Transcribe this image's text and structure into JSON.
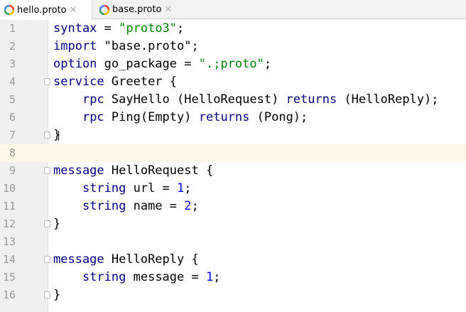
{
  "tabs": [
    {
      "label": "hello.proto",
      "active": true
    },
    {
      "label": "base.proto",
      "active": false
    }
  ],
  "colors": {
    "keyword": "#000080",
    "string": "#008000",
    "number": "#0000ff",
    "current_line": "#fdf8e5"
  },
  "lines": [
    {
      "num": "1",
      "tokens": [
        {
          "t": "syntax",
          "c": "kw"
        },
        {
          "t": " = "
        },
        {
          "t": "\"proto3\"",
          "c": "str"
        },
        {
          "t": ";"
        }
      ]
    },
    {
      "num": "2",
      "tokens": [
        {
          "t": "import",
          "c": "kw"
        },
        {
          "t": " \"base.proto\";"
        }
      ]
    },
    {
      "num": "3",
      "tokens": [
        {
          "t": "option",
          "c": "kw"
        },
        {
          "t": " go_package = "
        },
        {
          "t": "\".;proto\"",
          "c": "str"
        },
        {
          "t": ";"
        }
      ]
    },
    {
      "num": "4",
      "fold": true,
      "tokens": [
        {
          "t": "service",
          "c": "kw"
        },
        {
          "t": " Greeter {"
        }
      ]
    },
    {
      "num": "5",
      "tokens": [
        {
          "t": "    "
        },
        {
          "t": "rpc",
          "c": "kw"
        },
        {
          "t": " SayHello (HelloRequest) "
        },
        {
          "t": "returns",
          "c": "kw"
        },
        {
          "t": " (HelloReply);"
        }
      ]
    },
    {
      "num": "6",
      "tokens": [
        {
          "t": "    "
        },
        {
          "t": "rpc",
          "c": "kw"
        },
        {
          "t": " Ping(Empty) "
        },
        {
          "t": "returns",
          "c": "kw"
        },
        {
          "t": " (Pong);"
        }
      ]
    },
    {
      "num": "7",
      "fold": true,
      "caret": true,
      "tokens": [
        {
          "t": "}"
        }
      ]
    },
    {
      "num": "8",
      "current": true,
      "tokens": []
    },
    {
      "num": "9",
      "fold": true,
      "tokens": [
        {
          "t": "message",
          "c": "kw"
        },
        {
          "t": " HelloRequest {"
        }
      ]
    },
    {
      "num": "10",
      "tokens": [
        {
          "t": "    "
        },
        {
          "t": "string",
          "c": "kw"
        },
        {
          "t": " url = "
        },
        {
          "t": "1",
          "c": "num"
        },
        {
          "t": ";"
        }
      ]
    },
    {
      "num": "11",
      "tokens": [
        {
          "t": "    "
        },
        {
          "t": "string",
          "c": "kw"
        },
        {
          "t": " name = "
        },
        {
          "t": "2",
          "c": "num"
        },
        {
          "t": ";"
        }
      ]
    },
    {
      "num": "12",
      "fold": true,
      "tokens": [
        {
          "t": "}"
        }
      ]
    },
    {
      "num": "13",
      "tokens": []
    },
    {
      "num": "14",
      "fold": true,
      "tokens": [
        {
          "t": "message",
          "c": "kw"
        },
        {
          "t": " HelloReply {"
        }
      ]
    },
    {
      "num": "15",
      "tokens": [
        {
          "t": "    "
        },
        {
          "t": "string",
          "c": "kw"
        },
        {
          "t": " message = "
        },
        {
          "t": "1",
          "c": "num"
        },
        {
          "t": ";"
        }
      ]
    },
    {
      "num": "16",
      "fold": true,
      "tokens": [
        {
          "t": "}"
        }
      ]
    }
  ]
}
